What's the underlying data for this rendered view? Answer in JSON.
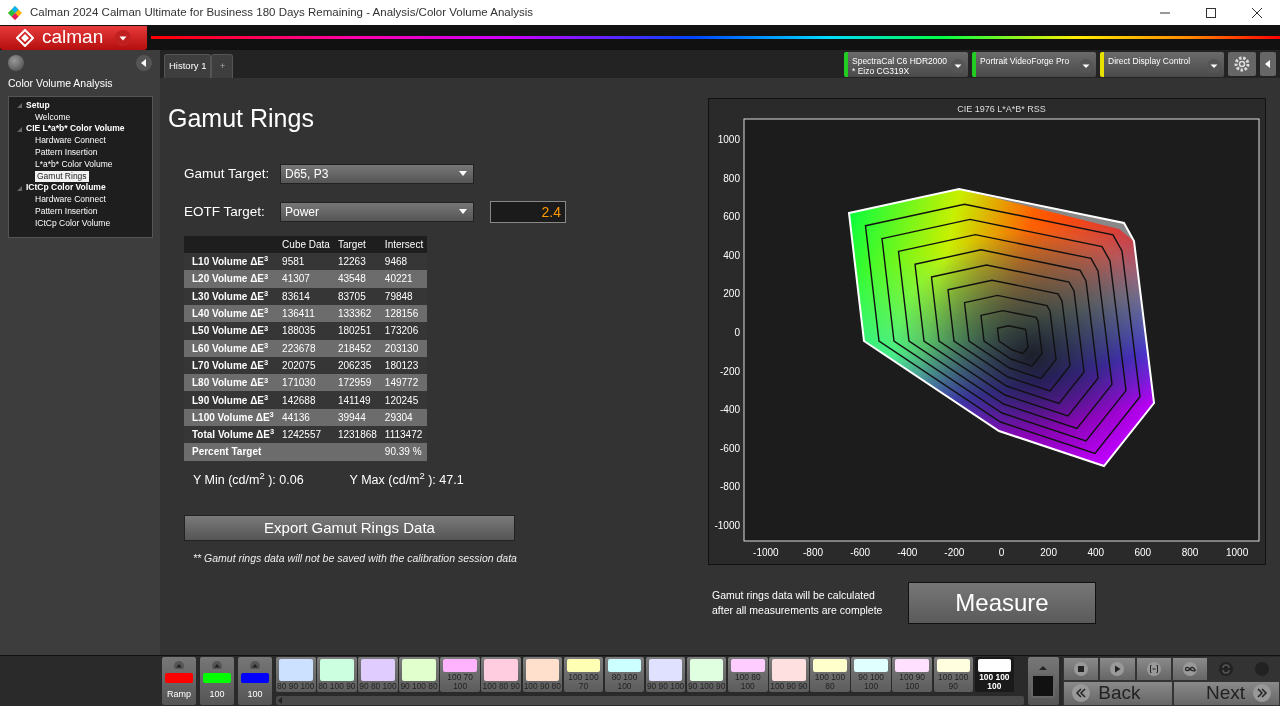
{
  "window": {
    "title": "Calman 2024 Calman Ultimate for Business 180 Days Remaining  - Analysis/Color Volume Analysis"
  },
  "app_logo": "calman",
  "tabs": [
    {
      "label": "History 1",
      "selected": true
    }
  ],
  "add_tab": "+",
  "devices": [
    {
      "lines": [
        "SpectraCal C6 HDR2000",
        "* Eizo CG319X"
      ],
      "color": "#22cc22"
    },
    {
      "lines": [
        "Portrait VideoForge Pro"
      ],
      "color": "#22cc22"
    },
    {
      "lines": [
        "Direct Display Control"
      ],
      "color": "#e8e000"
    }
  ],
  "sidebar": {
    "title": "Color Volume Analysis",
    "tree": [
      {
        "label": "Setup",
        "selected": false,
        "children": [
          {
            "label": "Welcome",
            "selected": false
          }
        ]
      },
      {
        "label": "CIE L*a*b* Color Volume",
        "selected": false,
        "children": [
          {
            "label": "Hardware Connect",
            "selected": false
          },
          {
            "label": "Pattern Insertion",
            "selected": false
          },
          {
            "label": "L*a*b* Color Volume",
            "selected": false
          },
          {
            "label": "Gamut Rings",
            "selected": true
          }
        ]
      },
      {
        "label": "ICtCp Color Volume",
        "selected": false,
        "children": [
          {
            "label": "Hardware Connect",
            "selected": false
          },
          {
            "label": "Pattern Insertion",
            "selected": false
          },
          {
            "label": "ICtCp Color Volume",
            "selected": false
          }
        ]
      }
    ]
  },
  "page": {
    "title": "Gamut Rings",
    "gamut_target": {
      "label": "Gamut Target:",
      "value": "D65, P3"
    },
    "eotf_target": {
      "label": "EOTF Target:",
      "value": "Power",
      "gamma": "2.4"
    },
    "table": {
      "columns": [
        "Cube Data",
        "Target",
        "Intersect"
      ],
      "rows": [
        {
          "label": "L10 Volume ΔE$^{3}$",
          "values": [
            "9581",
            "12263",
            "9468"
          ]
        },
        {
          "label": "L20 Volume ΔE$^{3}$",
          "values": [
            "41307",
            "43548",
            "40221"
          ]
        },
        {
          "label": "L30 Volume ΔE$^{3}$",
          "values": [
            "83614",
            "83705",
            "79848"
          ]
        },
        {
          "label": "L40 Volume ΔE$^{3}$",
          "values": [
            "136411",
            "133362",
            "128156"
          ]
        },
        {
          "label": "L50 Volume ΔE$^{3}$",
          "values": [
            "188035",
            "180251",
            "173206"
          ]
        },
        {
          "label": "L60 Volume ΔE$^{3}$",
          "values": [
            "223678",
            "218452",
            "203130"
          ]
        },
        {
          "label": "L70 Volume ΔE$^{3}$",
          "values": [
            "202075",
            "206235",
            "180123"
          ]
        },
        {
          "label": "L80 Volume ΔE$^{3}$",
          "values": [
            "171030",
            "172959",
            "149772"
          ]
        },
        {
          "label": "L90 Volume ΔE$^{3}$",
          "values": [
            "142688",
            "141149",
            "120245"
          ]
        },
        {
          "label": "L100 Volume ΔE$^{3}$",
          "values": [
            "44136",
            "39944",
            "29304"
          ]
        },
        {
          "label": "Total Volume ΔE$^{3}$",
          "values": [
            "1242557",
            "1231868",
            "1113472"
          ]
        },
        {
          "label": "Percent Target",
          "values": [
            "90.39 %"
          ]
        }
      ]
    },
    "y_min": "Y Min (cd/m$^{2}$ ): 0.06",
    "y_max": "Y Max (cd/m$^{2}$ ): 47.1",
    "export_button": "Export Gamut Rings Data",
    "note": "** Gamut rings data will not be saved with the calibration session data"
  },
  "chart": {
    "chart_data": {
      "type": "line",
      "title": "CIE 1976 L*A*B* RSS",
      "xlim": [
        -1093,
        1093
      ],
      "ylim": [
        -1083,
        1104
      ],
      "xticks": [
        -1000,
        -800,
        -600,
        -400,
        -200,
        0,
        200,
        400,
        600,
        800,
        1000
      ],
      "yticks": [
        -1000,
        -800,
        -600,
        -400,
        -200,
        0,
        200,
        400,
        600,
        800,
        1000
      ]
    }
  },
  "measure": {
    "message": [
      "Gamut rings data will be calculated",
      "after all measurements are complete"
    ],
    "button": "Measure"
  },
  "ramps": [
    {
      "label": "Ramp",
      "color": "#ff0000"
    },
    {
      "label": "100",
      "color": "#00ff00"
    },
    {
      "label": "100",
      "color": "#0000ff"
    }
  ],
  "patches": [
    {
      "label": "80 90 100",
      "color": "#cce0ff",
      "selected": false
    },
    {
      "label": "80 100 90",
      "color": "#ccffe0",
      "selected": false
    },
    {
      "label": "90 80 100",
      "color": "#e0ccff",
      "selected": false
    },
    {
      "label": "90 100 80",
      "color": "#e0ffcc",
      "selected": false
    },
    {
      "label": "100 70 100",
      "color": "#ffb3ff",
      "selected": false
    },
    {
      "label": "100 80 90",
      "color": "#ffcce0",
      "selected": false
    },
    {
      "label": "100 90 80",
      "color": "#ffe0cc",
      "selected": false
    },
    {
      "label": "100 100 70",
      "color": "#ffffb3",
      "selected": false
    },
    {
      "label": "80 100 100",
      "color": "#ccffff",
      "selected": false
    },
    {
      "label": "90 90 100",
      "color": "#e0e0ff",
      "selected": false
    },
    {
      "label": "90 100 90",
      "color": "#e0ffe0",
      "selected": false
    },
    {
      "label": "100 80 100",
      "color": "#ffccff",
      "selected": false
    },
    {
      "label": "100 90 90",
      "color": "#ffe0e0",
      "selected": false
    },
    {
      "label": "100 100 80",
      "color": "#ffffcc",
      "selected": false
    },
    {
      "label": "90 100 100",
      "color": "#e0ffff",
      "selected": false
    },
    {
      "label": "100 90 100",
      "color": "#ffe0ff",
      "selected": false
    },
    {
      "label": "100 100 90",
      "color": "#ffffe0",
      "selected": false
    },
    {
      "label": "100 100 100",
      "color": "#ffffff",
      "selected": true
    }
  ],
  "nav": {
    "back": "Back",
    "next": "Next"
  }
}
